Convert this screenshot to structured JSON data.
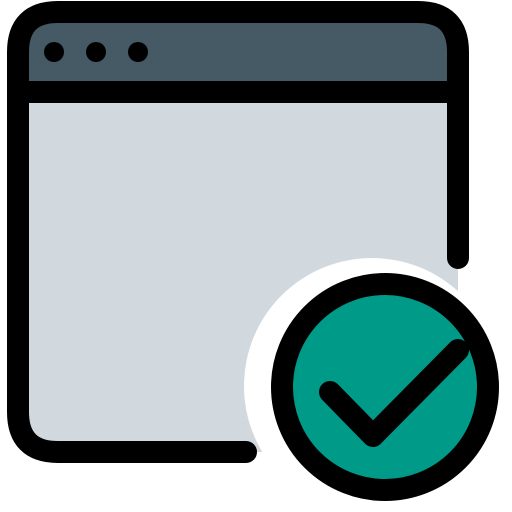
{
  "icon": {
    "name": "browser-window-check-icon",
    "window": {
      "titlebar_color": "#455a64",
      "body_color": "#d2d9de",
      "outline_color": "#000000",
      "dots": [
        "dot-1",
        "dot-2",
        "dot-3"
      ]
    },
    "badge": {
      "name": "check-circle-icon",
      "fill_color": "#009a88",
      "halo_color": "#ffffff",
      "outline_color": "#000000"
    }
  }
}
